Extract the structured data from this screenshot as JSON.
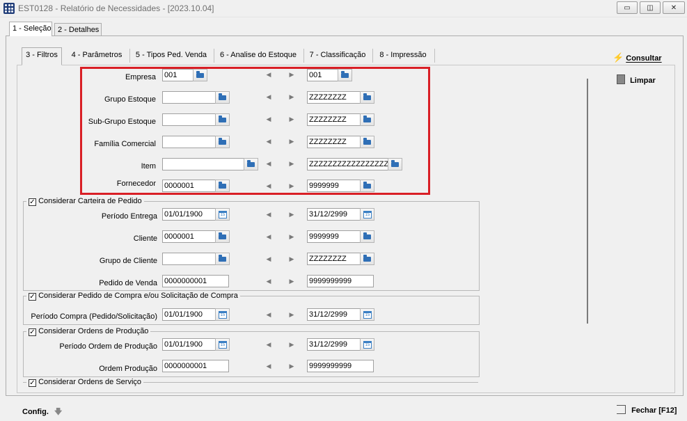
{
  "window": {
    "title": "EST0128 - Relatório de Necessidades - [2023.10.04]",
    "buttons": {
      "minimize": "▭",
      "restore": "◫",
      "close": "✕"
    }
  },
  "main_tabs": [
    {
      "label": "1 - Seleção",
      "active": true
    },
    {
      "label": "2 - Detalhes",
      "active": false
    }
  ],
  "sub_tabs": [
    {
      "label": "3 - Filtros",
      "active": true
    },
    {
      "label": "4 - Parâmetros",
      "active": false
    },
    {
      "label": "5 - Tipos Ped. Venda",
      "active": false
    },
    {
      "label": "6 - Analise do Estoque",
      "active": false
    },
    {
      "label": "7 - Classificação",
      "active": false
    },
    {
      "label": "8 - Impressão",
      "active": false
    }
  ],
  "filters": [
    {
      "label": "Empresa",
      "from": "001",
      "to": "001"
    },
    {
      "label": "Grupo Estoque",
      "from": "",
      "to": "ZZZZZZZZ"
    },
    {
      "label": "Sub-Grupo Estoque",
      "from": "",
      "to": "ZZZZZZZZ"
    },
    {
      "label": "Família Comercial",
      "from": "",
      "to": "ZZZZZZZZ"
    },
    {
      "label": "Item",
      "from": "",
      "to": "ZZZZZZZZZZZZZZZZZZZZ"
    },
    {
      "label": "Fornecedor",
      "from": "0000001",
      "to": "9999999"
    }
  ],
  "carteira": {
    "title": "Considerar Carteira de Pedido",
    "checked": true,
    "rows": [
      {
        "label": "Período Entrega",
        "from": "01/01/1900",
        "to": "31/12/2999"
      },
      {
        "label": "Cliente",
        "from": "0000001",
        "to": "9999999"
      },
      {
        "label": "Grupo de Cliente",
        "from": "",
        "to": "ZZZZZZZZ"
      },
      {
        "label": "Pedido de Venda",
        "from": "0000000001",
        "to": "9999999999"
      }
    ]
  },
  "compra": {
    "title": "Considerar Pedido de Compra e/ou Solicitação de Compra",
    "checked": true,
    "rows": [
      {
        "label": "Período Compra (Pedido/Solicitação)",
        "from": "01/01/1900",
        "to": "31/12/2999"
      }
    ]
  },
  "producao": {
    "title": "Considerar Ordens de Produção",
    "checked": true,
    "rows": [
      {
        "label": "Período Ordem de Produção",
        "from": "01/01/1900",
        "to": "31/12/2999"
      },
      {
        "label": "Ordem Produção",
        "from": "0000000001",
        "to": "9999999999"
      }
    ]
  },
  "servico": {
    "title": "Considerar Ordens de Serviço",
    "checked": true
  },
  "side_buttons": {
    "consultar": "Consultar",
    "limpar": "Limpar"
  },
  "footer": {
    "config": "Config.",
    "fechar": "Fechar [F12]"
  },
  "colors": {
    "highlight": "#d91f26",
    "icon_blue": "#2f6fb6"
  },
  "icons": {
    "lookup": "folder-lookup-icon",
    "calendar": "calendar-icon",
    "consultar": "lightning-icon",
    "limpar": "copy-icon",
    "fechar": "exit-icon"
  }
}
